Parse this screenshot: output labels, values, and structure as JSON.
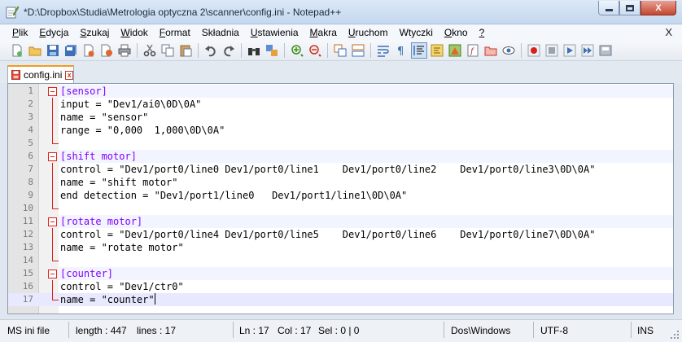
{
  "window": {
    "title": "*D:\\Dropbox\\Studia\\Metrologia optyczna 2\\scanner\\config.ini - Notepad++",
    "minimize_icon": "minimize-icon",
    "maximize_icon": "maximize-icon",
    "close_label": "X"
  },
  "menu": {
    "items": [
      {
        "u": "P",
        "rest": "lik"
      },
      {
        "u": "E",
        "rest": "dycja"
      },
      {
        "u": "S",
        "rest": "zukaj"
      },
      {
        "u": "W",
        "rest": "idok"
      },
      {
        "u": "F",
        "rest": "ormat"
      },
      {
        "u": "",
        "rest": "Składnia"
      },
      {
        "u": "U",
        "rest": "stawienia"
      },
      {
        "u": "M",
        "rest": "akra"
      },
      {
        "u": "U",
        "rest": "ruchom"
      },
      {
        "u": "",
        "rest": "Wtyczki"
      },
      {
        "u": "O",
        "rest": "kno"
      },
      {
        "u": "?",
        "rest": ""
      }
    ],
    "close": "X"
  },
  "tab": {
    "label": "config.ini",
    "close": "x"
  },
  "editor": {
    "lines": [
      {
        "n": "1",
        "text": "[sensor]",
        "section": true,
        "fold": "start"
      },
      {
        "n": "2",
        "text": "input = \"Dev1/ai0\\0D\\0A\"",
        "fold": "mid"
      },
      {
        "n": "3",
        "text": "name = \"sensor\"",
        "fold": "mid"
      },
      {
        "n": "4",
        "text": "range = \"0,000  1,000\\0D\\0A\"",
        "fold": "mid"
      },
      {
        "n": "5",
        "text": "",
        "fold": "end"
      },
      {
        "n": "6",
        "text": "[shift motor]",
        "section": true,
        "fold": "start"
      },
      {
        "n": "7",
        "text": "control = \"Dev1/port0/line0 Dev1/port0/line1    Dev1/port0/line2    Dev1/port0/line3\\0D\\0A\"",
        "fold": "mid"
      },
      {
        "n": "8",
        "text": "name = \"shift motor\"",
        "fold": "mid"
      },
      {
        "n": "9",
        "text": "end detection = \"Dev1/port1/line0   Dev1/port1/line1\\0D\\0A\"",
        "fold": "mid"
      },
      {
        "n": "10",
        "text": "",
        "fold": "end"
      },
      {
        "n": "11",
        "text": "[rotate motor]",
        "section": true,
        "fold": "start"
      },
      {
        "n": "12",
        "text": "control = \"Dev1/port0/line4 Dev1/port0/line5    Dev1/port0/line6    Dev1/port0/line7\\0D\\0A\"",
        "fold": "mid"
      },
      {
        "n": "13",
        "text": "name = \"rotate motor\"",
        "fold": "mid"
      },
      {
        "n": "14",
        "text": "",
        "fold": "end"
      },
      {
        "n": "15",
        "text": "[counter]",
        "section": true,
        "fold": "start"
      },
      {
        "n": "16",
        "text": "control = \"Dev1/ctr0\"",
        "fold": "mid"
      },
      {
        "n": "17",
        "text": "name = \"counter\"",
        "fold": "last",
        "current": true
      }
    ]
  },
  "status": {
    "language": "MS ini file",
    "length": "length : 447",
    "lines": "lines : 17",
    "ln": "Ln : 17",
    "col": "Col : 17",
    "sel": "Sel : 0 | 0",
    "eol": "Dos\\Windows",
    "encoding": "UTF-8",
    "mode": "INS"
  },
  "colors": {
    "section_keyword": "#8000ff",
    "fold_marker": "#e0201b",
    "tab_accent": "#f39b1c"
  }
}
